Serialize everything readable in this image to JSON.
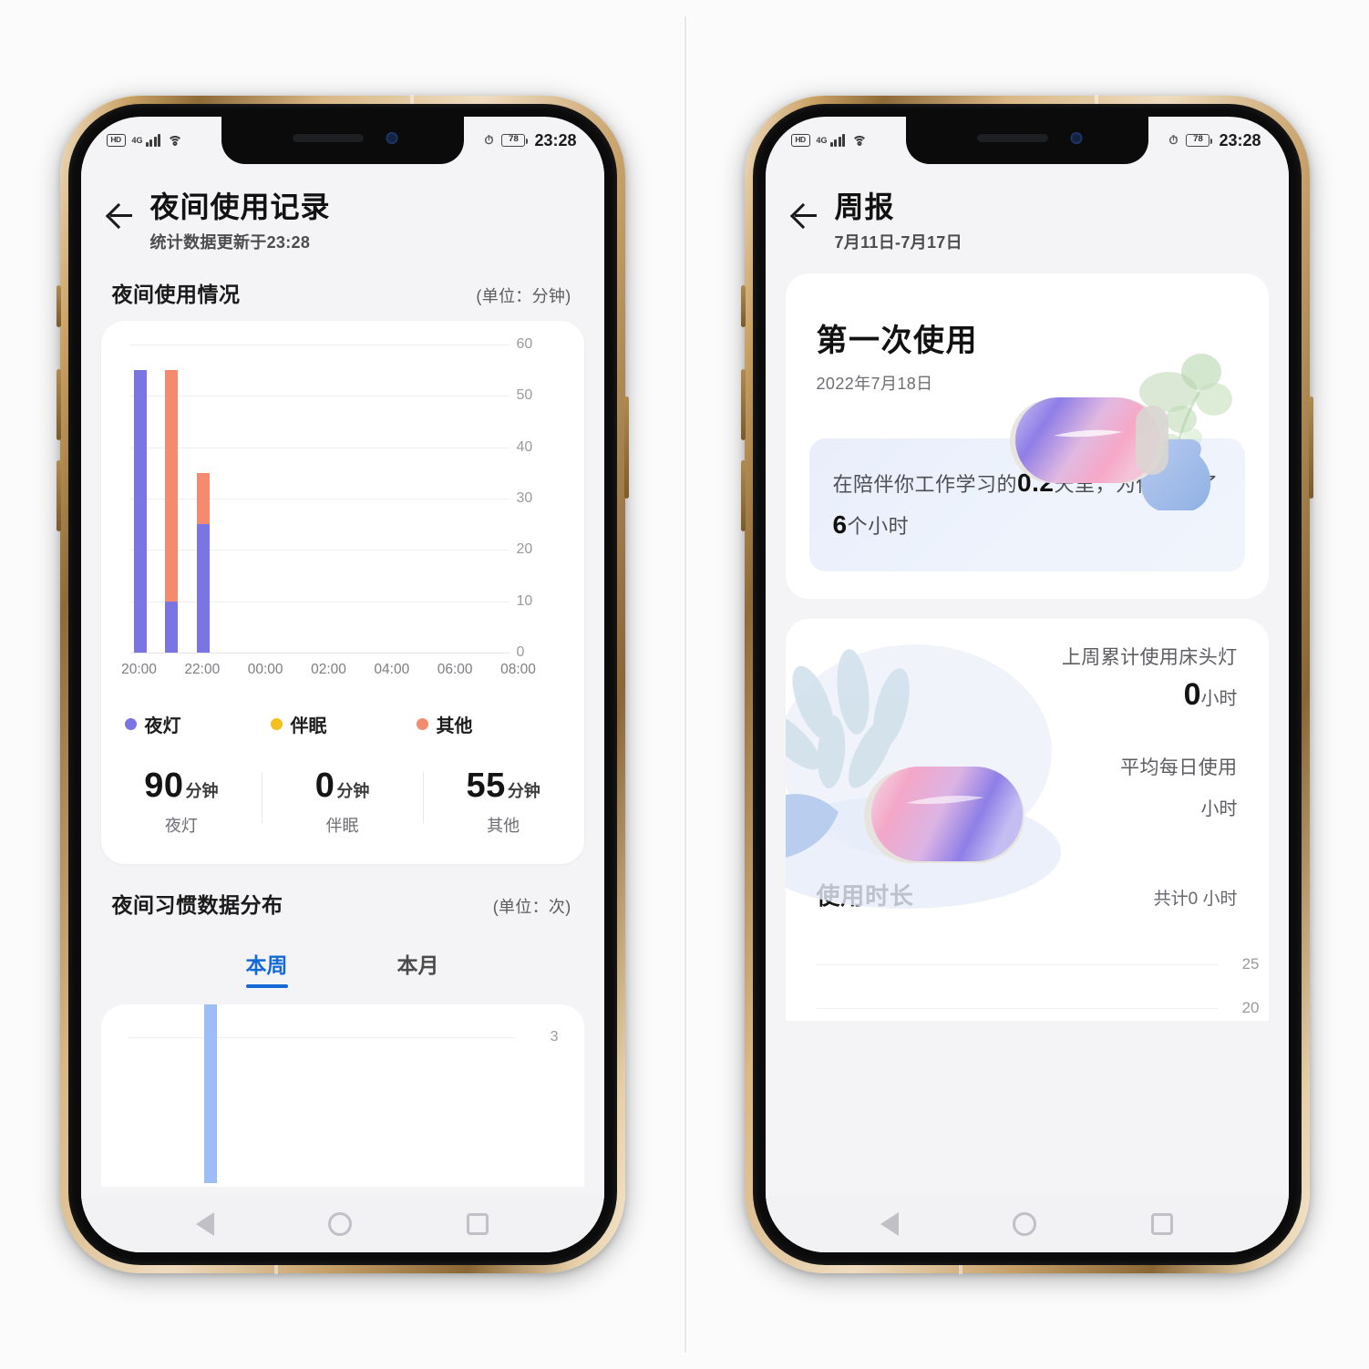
{
  "status_bar": {
    "hd_label": "HD",
    "network_label": "4G",
    "battery_level": "78",
    "time": "23:28",
    "icons": [
      "hd-icon",
      "signal-bars-icon",
      "wifi-icon",
      "battery-icon"
    ]
  },
  "colors": {
    "night_light": "#7B74E3",
    "sleep_aid": "#F4C01F",
    "other": "#F58A6E",
    "accent_blue": "#1569D6",
    "mini_bar": "#9DBDF5",
    "screen_bg": "#F4F4F6",
    "card_bg": "#FFFFFF"
  },
  "left_phone": {
    "appbar": {
      "title": "夜间使用记录",
      "subtitle": "统计数据更新于23:28",
      "back_label": "返回"
    },
    "section_usage": {
      "title": "夜间使用情况",
      "unit": "(单位：分钟)"
    },
    "legend": [
      {
        "label": "夜灯",
        "color": "#7B74E3"
      },
      {
        "label": "伴眠",
        "color": "#F4C01F"
      },
      {
        "label": "其他",
        "color": "#F58A6E"
      }
    ],
    "stats": [
      {
        "value": "90",
        "unit": "分钟",
        "label": "夜灯"
      },
      {
        "value": "0",
        "unit": "分钟",
        "label": "伴眠"
      },
      {
        "value": "55",
        "unit": "分钟",
        "label": "其他"
      }
    ],
    "section_habits": {
      "title": "夜间习惯数据分布",
      "unit": "(单位：次)"
    },
    "tabs": [
      {
        "label": "本周",
        "active": true
      },
      {
        "label": "本月",
        "active": false
      }
    ]
  },
  "right_phone": {
    "appbar": {
      "title": "周报",
      "subtitle": "7月11日-7月17日",
      "back_label": "返回"
    },
    "first_use_card": {
      "title": "第一次使用",
      "date": "2022年7月18日",
      "illustration": "lamp-and-plant-illustration",
      "message_prefix": "在陪伴你工作学习的",
      "message_days": "0.2",
      "message_middle": "天里，为你服务了",
      "message_hours": "6",
      "message_suffix": "个小时"
    },
    "summary_card": {
      "illustration": "lamp-and-leaves-illustration",
      "stat_1_label": "上周累计使用床头灯",
      "stat_1_value": "0",
      "stat_1_unit": "小时",
      "stat_2_label": "平均每日使用",
      "stat_2_value": "",
      "stat_2_unit": "小时",
      "usage_title": "使用时长",
      "usage_total": "共计0 小时"
    }
  },
  "nav_bar": {
    "back": "back-triangle-icon",
    "home": "home-circle-icon",
    "recents": "recents-square-icon"
  },
  "chart_data": [
    {
      "id": "night-usage-chart",
      "type": "bar",
      "stacked": true,
      "title": "夜间使用情况",
      "xlabel": "",
      "ylabel": "分钟",
      "unit": "分钟",
      "ylim": [
        0,
        60
      ],
      "yticks": [
        0,
        10,
        20,
        30,
        40,
        50,
        60
      ],
      "xticks": [
        "20:00",
        "22:00",
        "00:00",
        "02:00",
        "04:00",
        "06:00",
        "08:00"
      ],
      "x_hours": [
        "20:00",
        "21:00",
        "22:00",
        "23:00",
        "00:00",
        "01:00",
        "02:00",
        "03:00",
        "04:00",
        "05:00",
        "06:00",
        "07:00",
        "08:00"
      ],
      "grid": true,
      "legend_position": "bottom",
      "series": [
        {
          "name": "夜灯",
          "color": "#7B74E3",
          "values": [
            55,
            10,
            25,
            0,
            0,
            0,
            0,
            0,
            0,
            0,
            0,
            0,
            0
          ]
        },
        {
          "name": "伴眠",
          "color": "#F4C01F",
          "values": [
            0,
            0,
            0,
            0,
            0,
            0,
            0,
            0,
            0,
            0,
            0,
            0,
            0
          ]
        },
        {
          "name": "其他",
          "color": "#F58A6E",
          "values": [
            0,
            45,
            10,
            0,
            0,
            0,
            0,
            0,
            0,
            0,
            0,
            0,
            0
          ]
        }
      ]
    },
    {
      "id": "night-habit-distribution-chart",
      "type": "bar",
      "title": "夜间习惯数据分布",
      "unit": "次",
      "ylim": [
        0,
        3
      ],
      "yticks": [
        3
      ],
      "grid": true,
      "series": [
        {
          "name": "本周",
          "color": "#9DBDF5",
          "values": [
            0,
            3,
            0,
            0,
            0,
            0,
            0
          ]
        }
      ]
    },
    {
      "id": "usage-duration-chart",
      "type": "bar",
      "title": "使用时长",
      "unit": "小时",
      "total_label": "共计0 小时",
      "yticks": [
        25,
        20
      ],
      "grid": true,
      "series": [
        {
          "name": "使用时长",
          "color": "#9DBDF5",
          "values": [
            0,
            0,
            0,
            0,
            0,
            0,
            0
          ]
        }
      ]
    }
  ]
}
